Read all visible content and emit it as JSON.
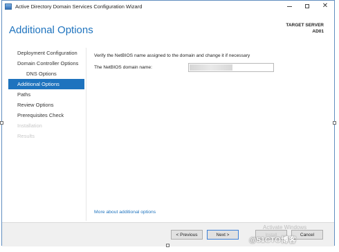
{
  "window": {
    "title": "Active Directory Domain Services Configuration Wizard"
  },
  "header": {
    "page_title": "Additional Options",
    "target_label": "TARGET SERVER",
    "target_name": "AD01"
  },
  "nav": {
    "items": [
      {
        "label": "Deployment Configuration",
        "state": "normal"
      },
      {
        "label": "Domain Controller Options",
        "state": "normal"
      },
      {
        "label": "DNS Options",
        "state": "sub"
      },
      {
        "label": "Additional Options",
        "state": "active"
      },
      {
        "label": "Paths",
        "state": "normal"
      },
      {
        "label": "Review Options",
        "state": "normal"
      },
      {
        "label": "Prerequisites Check",
        "state": "normal"
      },
      {
        "label": "Installation",
        "state": "disabled"
      },
      {
        "label": "Results",
        "state": "disabled"
      }
    ]
  },
  "main": {
    "instruction": "Verify the NetBIOS name assigned to the domain and change it if necessary",
    "netbios_label": "The NetBIOS domain name:",
    "netbios_value": "",
    "more_link": "More about additional options"
  },
  "footer": {
    "previous_label": "< Previous",
    "next_label": "Next >",
    "install_label": "Install",
    "cancel_label": "Cancel"
  },
  "overlay": {
    "watermark": "Activate Windows",
    "credit": "@51CTO博客"
  },
  "colors": {
    "accent": "#1e73be",
    "frame_border": "#5f8dbf"
  }
}
